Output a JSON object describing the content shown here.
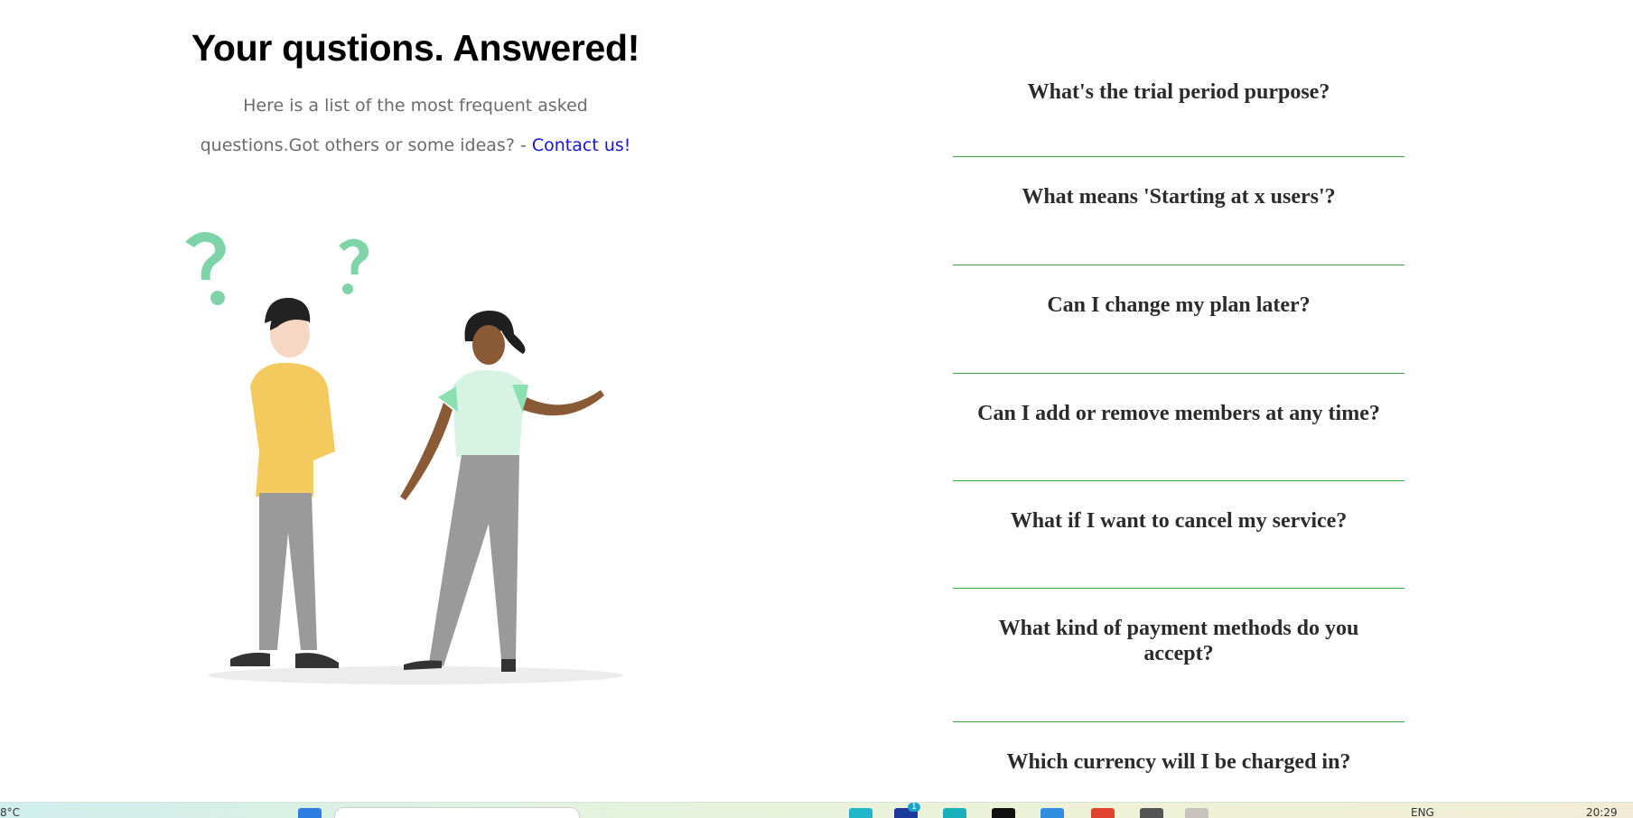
{
  "left": {
    "title": "Your qustions. Answered!",
    "subtitle": "Here is a list of the most frequent asked questions.Got others or some ideas? - ",
    "contact_link": "Contact us!"
  },
  "faq": {
    "items": [
      {
        "question": "What's the trial period purpose?"
      },
      {
        "question": "What means 'Starting at x users'?"
      },
      {
        "question": "Can I change my plan later?"
      },
      {
        "question": "Can I add or remove members at any time?"
      },
      {
        "question": "What if I want to cancel my service?"
      },
      {
        "question": "What kind of payment methods do you accept?"
      },
      {
        "question": "Which currency will I be charged in?"
      }
    ]
  },
  "taskbar": {
    "weather": "8°C",
    "language": "ENG",
    "time": "20:29",
    "badge_count": "1"
  },
  "colors": {
    "divider": "#3aa34a",
    "link": "#1515d8",
    "question_text": "#2b2b2b",
    "subtitle_text": "#6b6b6b"
  }
}
